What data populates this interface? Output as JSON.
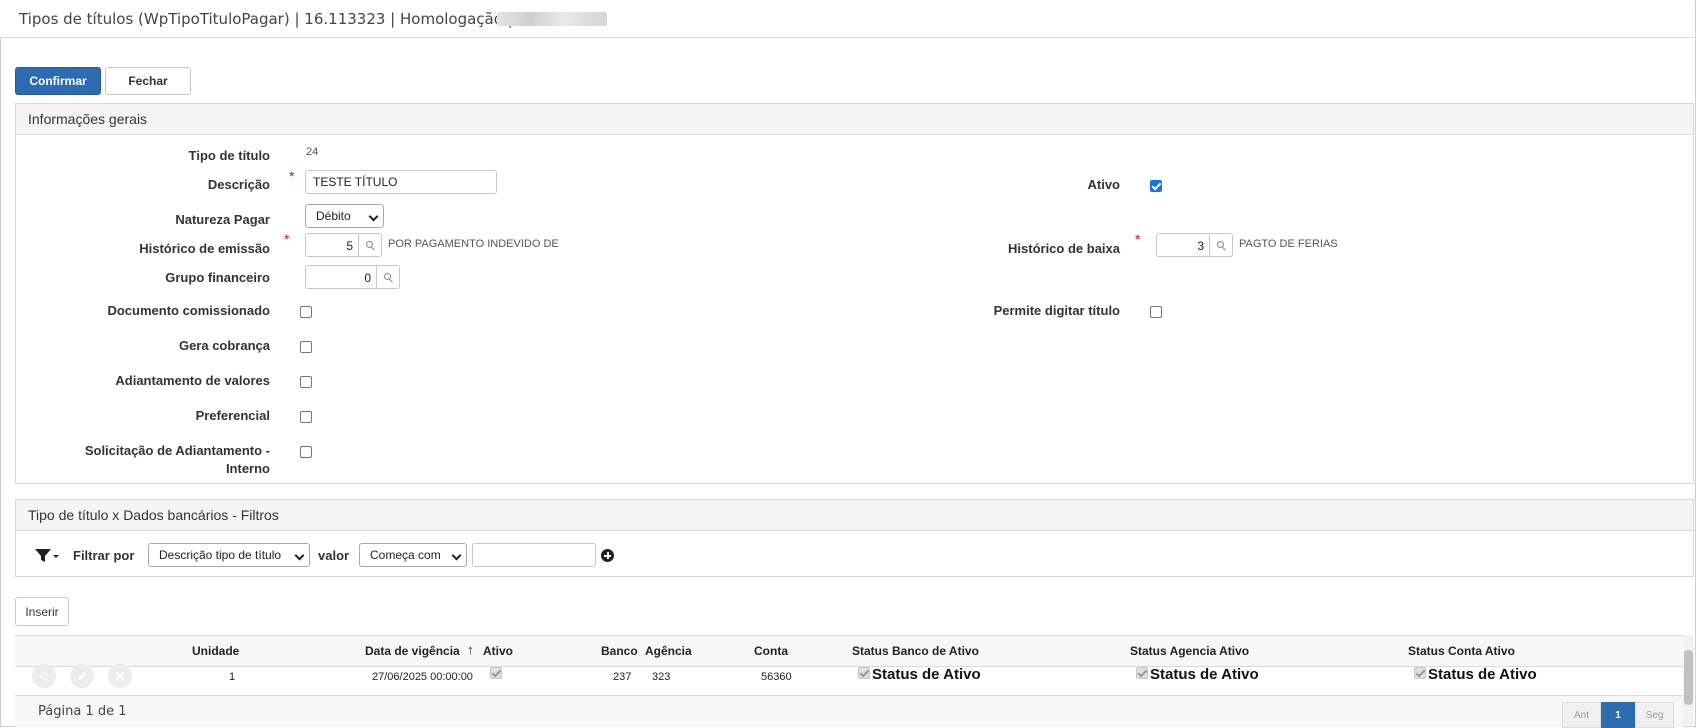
{
  "window": {
    "title": "Tipos de títulos (WpTipoTituloPagar) | 16.113323 | Homologação | S"
  },
  "toolbar": {
    "confirm_label": "Confirmar",
    "close_label": "Fechar"
  },
  "general": {
    "header": "Informações gerais",
    "tipo_titulo": {
      "label": "Tipo de título",
      "value": "24"
    },
    "descricao": {
      "label": "Descrição",
      "value": "TESTE TÍTULO"
    },
    "ativo": {
      "label": "Ativo",
      "checked": true
    },
    "natureza": {
      "label": "Natureza Pagar",
      "value": "Débito"
    },
    "hist_emissao": {
      "label": "Histórico de emissão",
      "value": "5",
      "desc": "POR PAGAMENTO INDEVIDO DE"
    },
    "hist_baixa": {
      "label": "Histórico de baixa",
      "value": "3",
      "desc": "PAGTO DE FERIAS"
    },
    "grupo_fin": {
      "label": "Grupo financeiro",
      "value": "0"
    },
    "doc_comissionado": {
      "label": "Documento comissionado",
      "checked": false
    },
    "permite_digitar": {
      "label": "Permite digitar título",
      "checked": false
    },
    "gera_cobranca": {
      "label": "Gera cobrança",
      "checked": false
    },
    "adiantamento": {
      "label": "Adiantamento de valores",
      "checked": false
    },
    "preferencial": {
      "label": "Preferencial",
      "checked": false
    },
    "solicitacao_l1": "Solicitação de Adiantamento -",
    "solicitacao_l2": "Interno"
  },
  "filters": {
    "header": "Tipo de título x Dados bancários - Filtros",
    "filter_by_label": "Filtrar por",
    "filter_field": "Descrição tipo de título",
    "value_label": "valor",
    "operator": "Começa com",
    "value": ""
  },
  "grid": {
    "insert_label": "Inserir",
    "columns": {
      "unidade": "Unidade",
      "data": "Data de vigência",
      "ativo": "Ativo",
      "banco": "Banco",
      "agencia": "Agência",
      "conta": "Conta",
      "status_banco": "Status Banco de Ativo",
      "status_agencia": "Status Agencia Ativo",
      "status_conta": "Status Conta Ativo"
    },
    "row": {
      "unidade": "1",
      "data": "27/06/2025 00:00:00",
      "banco": "237",
      "agencia": "323",
      "conta": "56360",
      "status_banco": "Status de Ativo",
      "status_agencia": "Status de Ativo",
      "status_conta": "Status de Ativo"
    },
    "sort_arrow": "↑",
    "page_info": "Página 1 de 1",
    "pager": {
      "prev": "Ant",
      "current": "1",
      "next": "Seg"
    }
  },
  "colors": {
    "primary": "#2d6cb0",
    "required": "#dd1122",
    "checkbox_checked": "#1a73e8"
  }
}
